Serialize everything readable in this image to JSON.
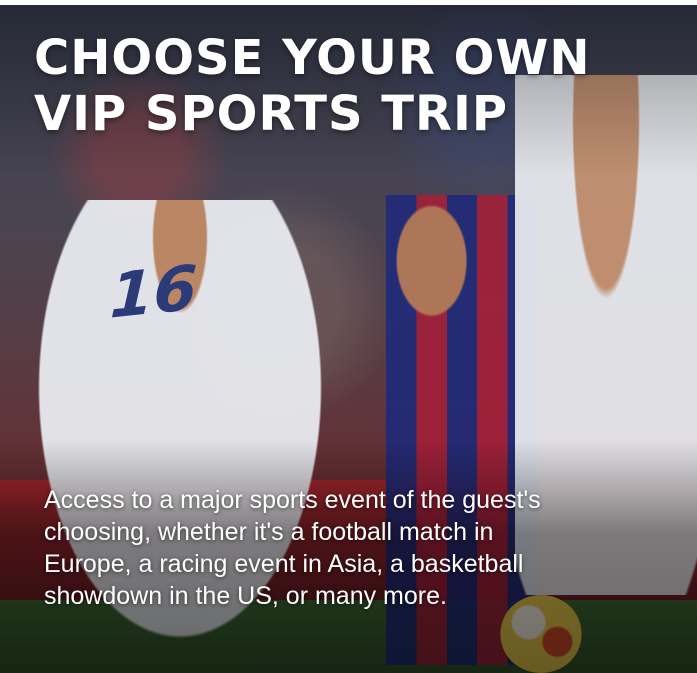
{
  "promo": {
    "headline_line1": "CHOOSE YOUR OWN",
    "headline_line2": "VIP SPORTS TRIP",
    "description_lines": [
      "Access to a major sports event of the guest's",
      "choosing, whether it's a football match in",
      "Europe, a racing event in Asia, a basketball",
      "showdown in the US, or many more."
    ]
  },
  "photo": {
    "subject": "football-players-photo",
    "colors": {
      "kit_blue": "#1f2a7a",
      "kit_red": "#a3203a",
      "kit_white": "#e9ebf0",
      "shirt_number_color": "#2b3b78"
    },
    "shirt_number": "16"
  }
}
